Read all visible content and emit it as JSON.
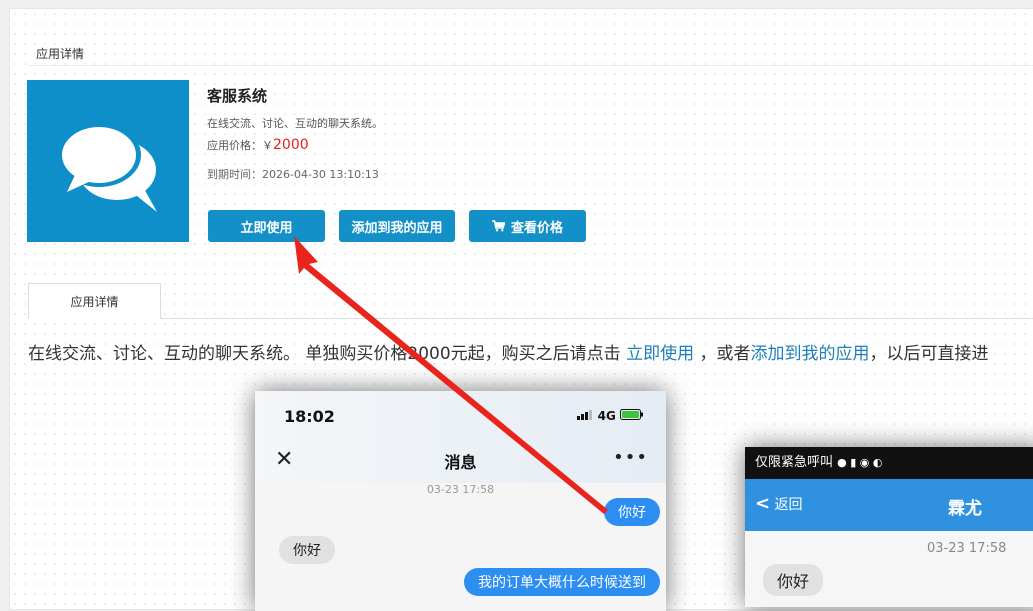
{
  "breadcrumb": "应用详情",
  "app": {
    "name": "客服系统",
    "description": "在线交流、讨论、互动的聊天系统。",
    "price_label": "应用价格：￥",
    "price_value": "2000",
    "expire_label": "到期时间：2026-04-30 13:10:13"
  },
  "buttons": {
    "use_now": "立即使用",
    "add_to_my_apps": "添加到我的应用",
    "view_price": "查看价格"
  },
  "tab": {
    "label": "应用详情"
  },
  "detail": {
    "text1": "在线交流、讨论、互动的聊天系统。 单独购买价格2000元起，购买之后请点击 ",
    "link1": "立即使用",
    "text2": " ，或者",
    "link2": "添加到我的应用",
    "text3": "，以后可直接进"
  },
  "phone1": {
    "time": "18:02",
    "signal": "4G",
    "title": "消息",
    "timestamp": "03-23 17:58",
    "msg_me_1": "你好",
    "msg_other_1": "你好",
    "msg_me_2": "我的订单大概什么时候送到"
  },
  "phone2": {
    "status_text": "仅限紧急呼叫",
    "back": "返回",
    "title": "霖尤",
    "timestamp": "03-23 17:58",
    "msg_other_1": "你好"
  },
  "colors": {
    "primary": "#1390c8",
    "price": "#e02020",
    "link": "#1e7fb8",
    "arrow": "#e8241c"
  }
}
